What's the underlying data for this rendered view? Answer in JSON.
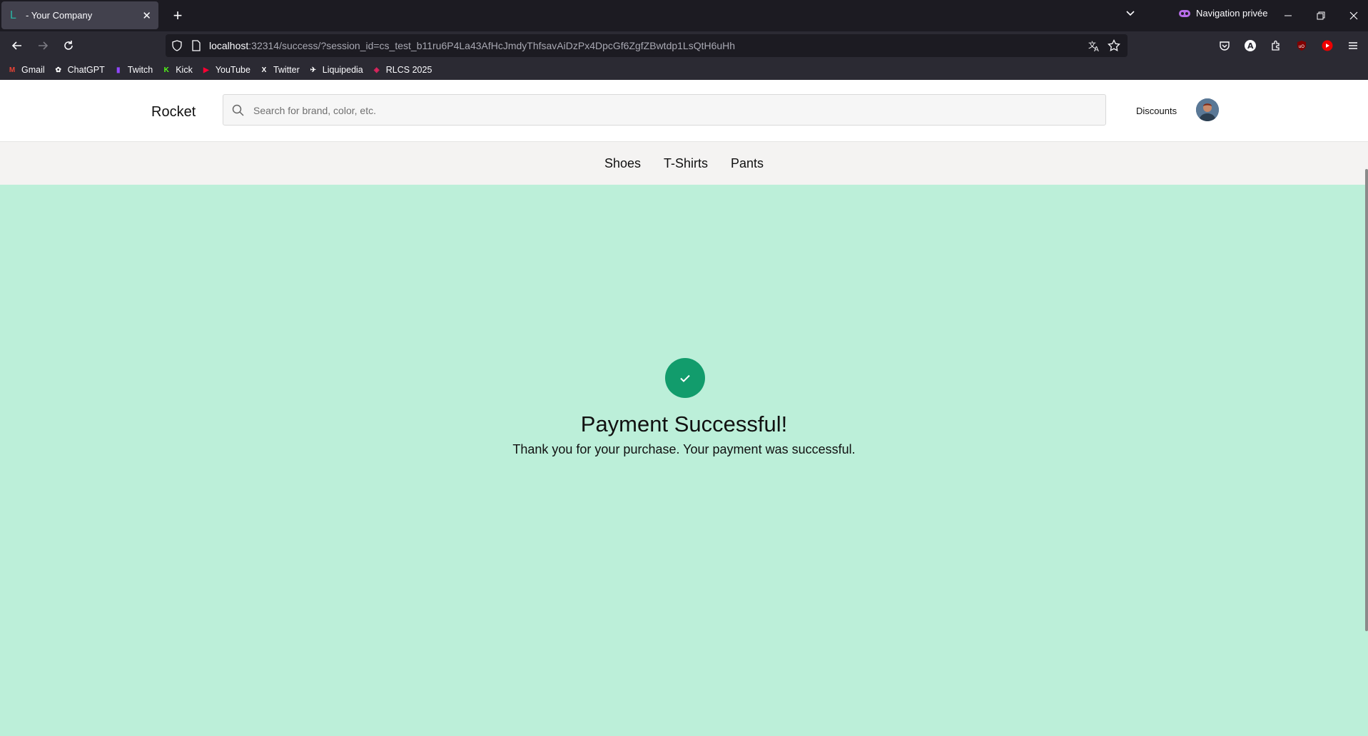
{
  "browser": {
    "tab": {
      "favicon": "L",
      "title": "- Your Company"
    },
    "private_label": "Navigation privée",
    "url": {
      "host": "localhost",
      "rest": ":32314/success/?session_id=cs_test_b11ru6P4La43AfHcJmdyThfsavAiDzPx4DpcGf6ZgfZBwtdp1LsQtH6uHh"
    },
    "bookmarks": [
      {
        "label": "Gmail",
        "icon": "gmail-icon",
        "color": "#ea4335",
        "glyph": "M"
      },
      {
        "label": "ChatGPT",
        "icon": "chatgpt-icon",
        "color": "#ffffff",
        "glyph": "✿"
      },
      {
        "label": "Twitch",
        "icon": "twitch-icon",
        "color": "#9146ff",
        "glyph": "▮"
      },
      {
        "label": "Kick",
        "icon": "kick-icon",
        "color": "#53fc18",
        "glyph": "K"
      },
      {
        "label": "YouTube",
        "icon": "youtube-icon",
        "color": "#ff0033",
        "glyph": "▶"
      },
      {
        "label": "Twitter",
        "icon": "x-icon",
        "color": "#ffffff",
        "glyph": "X"
      },
      {
        "label": "Liquipedia",
        "icon": "liquipedia-icon",
        "color": "#ffffff",
        "glyph": "✈"
      },
      {
        "label": "RLCS 2025",
        "icon": "rlcs-icon",
        "color": "#e0245e",
        "glyph": "◈"
      }
    ]
  },
  "site": {
    "brand": "Rocket",
    "search_placeholder": "Search for brand, color, etc.",
    "discounts": "Discounts",
    "categories": [
      "Shoes",
      "T-Shirts",
      "Pants"
    ]
  },
  "success": {
    "title": "Payment Successful!",
    "message": "Thank you for your purchase. Your payment was successful.",
    "accent": "#129c6c",
    "background": "#bcefd9"
  }
}
